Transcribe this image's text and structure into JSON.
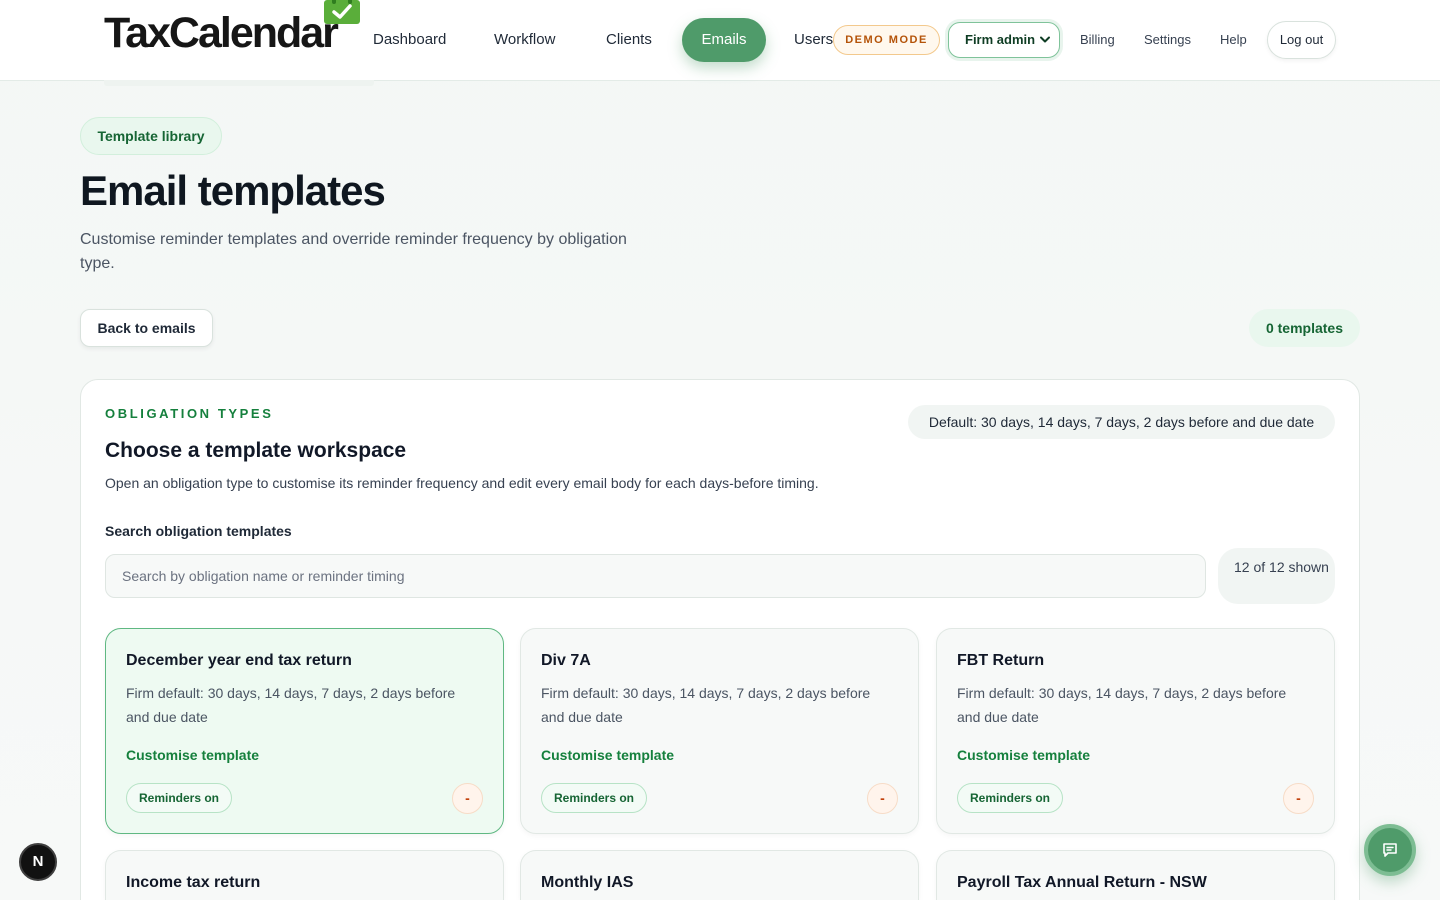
{
  "brand": {
    "name": "TaxCalendar",
    "accent": "#4f9b6a",
    "logo_icon": "calendar-check-icon"
  },
  "nav": {
    "items": [
      {
        "label": "Dashboard"
      },
      {
        "label": "Workflow"
      },
      {
        "label": "Clients"
      },
      {
        "label": "Emails",
        "active": true
      },
      {
        "label": "Users"
      }
    ],
    "demo_badge": "DEMO MODE",
    "firm_select": {
      "value": "Firm admin"
    },
    "billing": "Billing",
    "settings": "Settings",
    "help": "Help",
    "logout": "Log out"
  },
  "header": {
    "eyebrow_pill": "Template library",
    "title": "Email templates",
    "subtitle": "Customise reminder templates and override reminder frequency by obligation type.",
    "back_button": "Back to emails",
    "count_pill": "0 templates"
  },
  "panel": {
    "eyebrow": "OBLIGATION TYPES",
    "default_pill": "Default: 30 days, 14 days, 7 days, 2 days before and due date",
    "title": "Choose a template workspace",
    "description": "Open an obligation type to customise its reminder frequency and edit every email body for each days-before timing.",
    "search": {
      "label": "Search obligation templates",
      "placeholder": "Search by obligation name or reminder timing",
      "value": "",
      "shown": "12 of 12 shown"
    },
    "cards": [
      {
        "title": "December year end tax return",
        "desc": "Firm default: 30 days, 14 days, 7 days, 2 days before and due date",
        "link": "Customise template",
        "badge": "Reminders on",
        "action": "-",
        "selected": true
      },
      {
        "title": "Div 7A",
        "desc": "Firm default: 30 days, 14 days, 7 days, 2 days before and due date",
        "link": "Customise template",
        "badge": "Reminders on",
        "action": "-"
      },
      {
        "title": "FBT Return",
        "desc": "Firm default: 30 days, 14 days, 7 days, 2 days before and due date",
        "link": "Customise template",
        "badge": "Reminders on",
        "action": "-"
      },
      {
        "title": "Income tax return"
      },
      {
        "title": "Monthly IAS"
      },
      {
        "title": "Payroll Tax Annual Return - NSW"
      }
    ]
  },
  "floating": {
    "dev_badge": "N",
    "chat_icon": "chat-icon"
  }
}
